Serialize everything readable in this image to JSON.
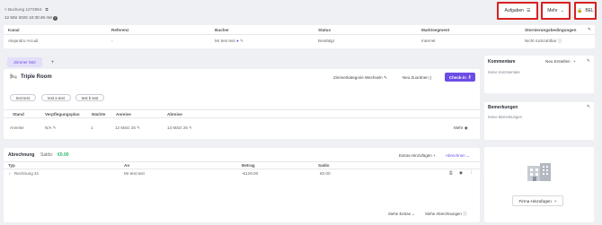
{
  "header": {
    "back_label": "< Buchung 1272984",
    "date": "12 Mär 2026 10:30:49 AM",
    "aufgaben": "Aufgaben",
    "mehr": "Mehr",
    "bel": "BEL"
  },
  "top_table": {
    "headers": [
      "Kanal",
      "Referenz",
      "Bucher",
      "Status",
      "Marktsegment",
      "Stornierungsbedingungen"
    ],
    "row": [
      "Alejandro Arcudi",
      "-",
      "Mr test test",
      "Bestätigt",
      "Internet",
      "Nicht rückzahlbar"
    ]
  },
  "room_tab": {
    "tab_label": "Zimmer 502",
    "add_label": "+",
    "room_title": "Triple Room",
    "change_category": "Zimmerkategorie Wechseln",
    "new_assign": "Neu Zuordnen",
    "checkin": "Check-in",
    "guests": [
      "test test",
      "test a test",
      "test b test"
    ],
    "stay_headers": [
      "Stand",
      "Verpflegungsplan",
      "Nächte",
      "Anreise",
      "Abreise"
    ],
    "stay_row": [
      "Anreise",
      "N/A",
      "1",
      "12 März 26",
      "13 März 26"
    ],
    "more_label": "Mehr"
  },
  "billing": {
    "title": "Abrechnung",
    "saldo_label": "Saldo:",
    "saldo_value": "€0.00",
    "add_extras": "Extras Hinzufügen",
    "billing_btn": "Abrechnen",
    "headers": [
      "Typ",
      "An",
      "Betrag",
      "Saldo"
    ],
    "row": [
      "Rechnung 31",
      "Mr test test",
      "-€129.00",
      "€0.00"
    ],
    "show_extras": "Siehe Extras",
    "show_billings": "Siehe Abrechnungen"
  },
  "comments": {
    "title": "Kommentare",
    "new_label": "Neu Erstellen",
    "empty": "Keine Kommentare"
  },
  "remarks": {
    "title": "Bemerkungen",
    "empty": "Keine Bemerkungen"
  },
  "company": {
    "add_label": "Firma Hinzufügen"
  },
  "colors": {
    "accent": "#6c4de6",
    "highlight": "#d92020",
    "saldo": "#2bb673"
  }
}
